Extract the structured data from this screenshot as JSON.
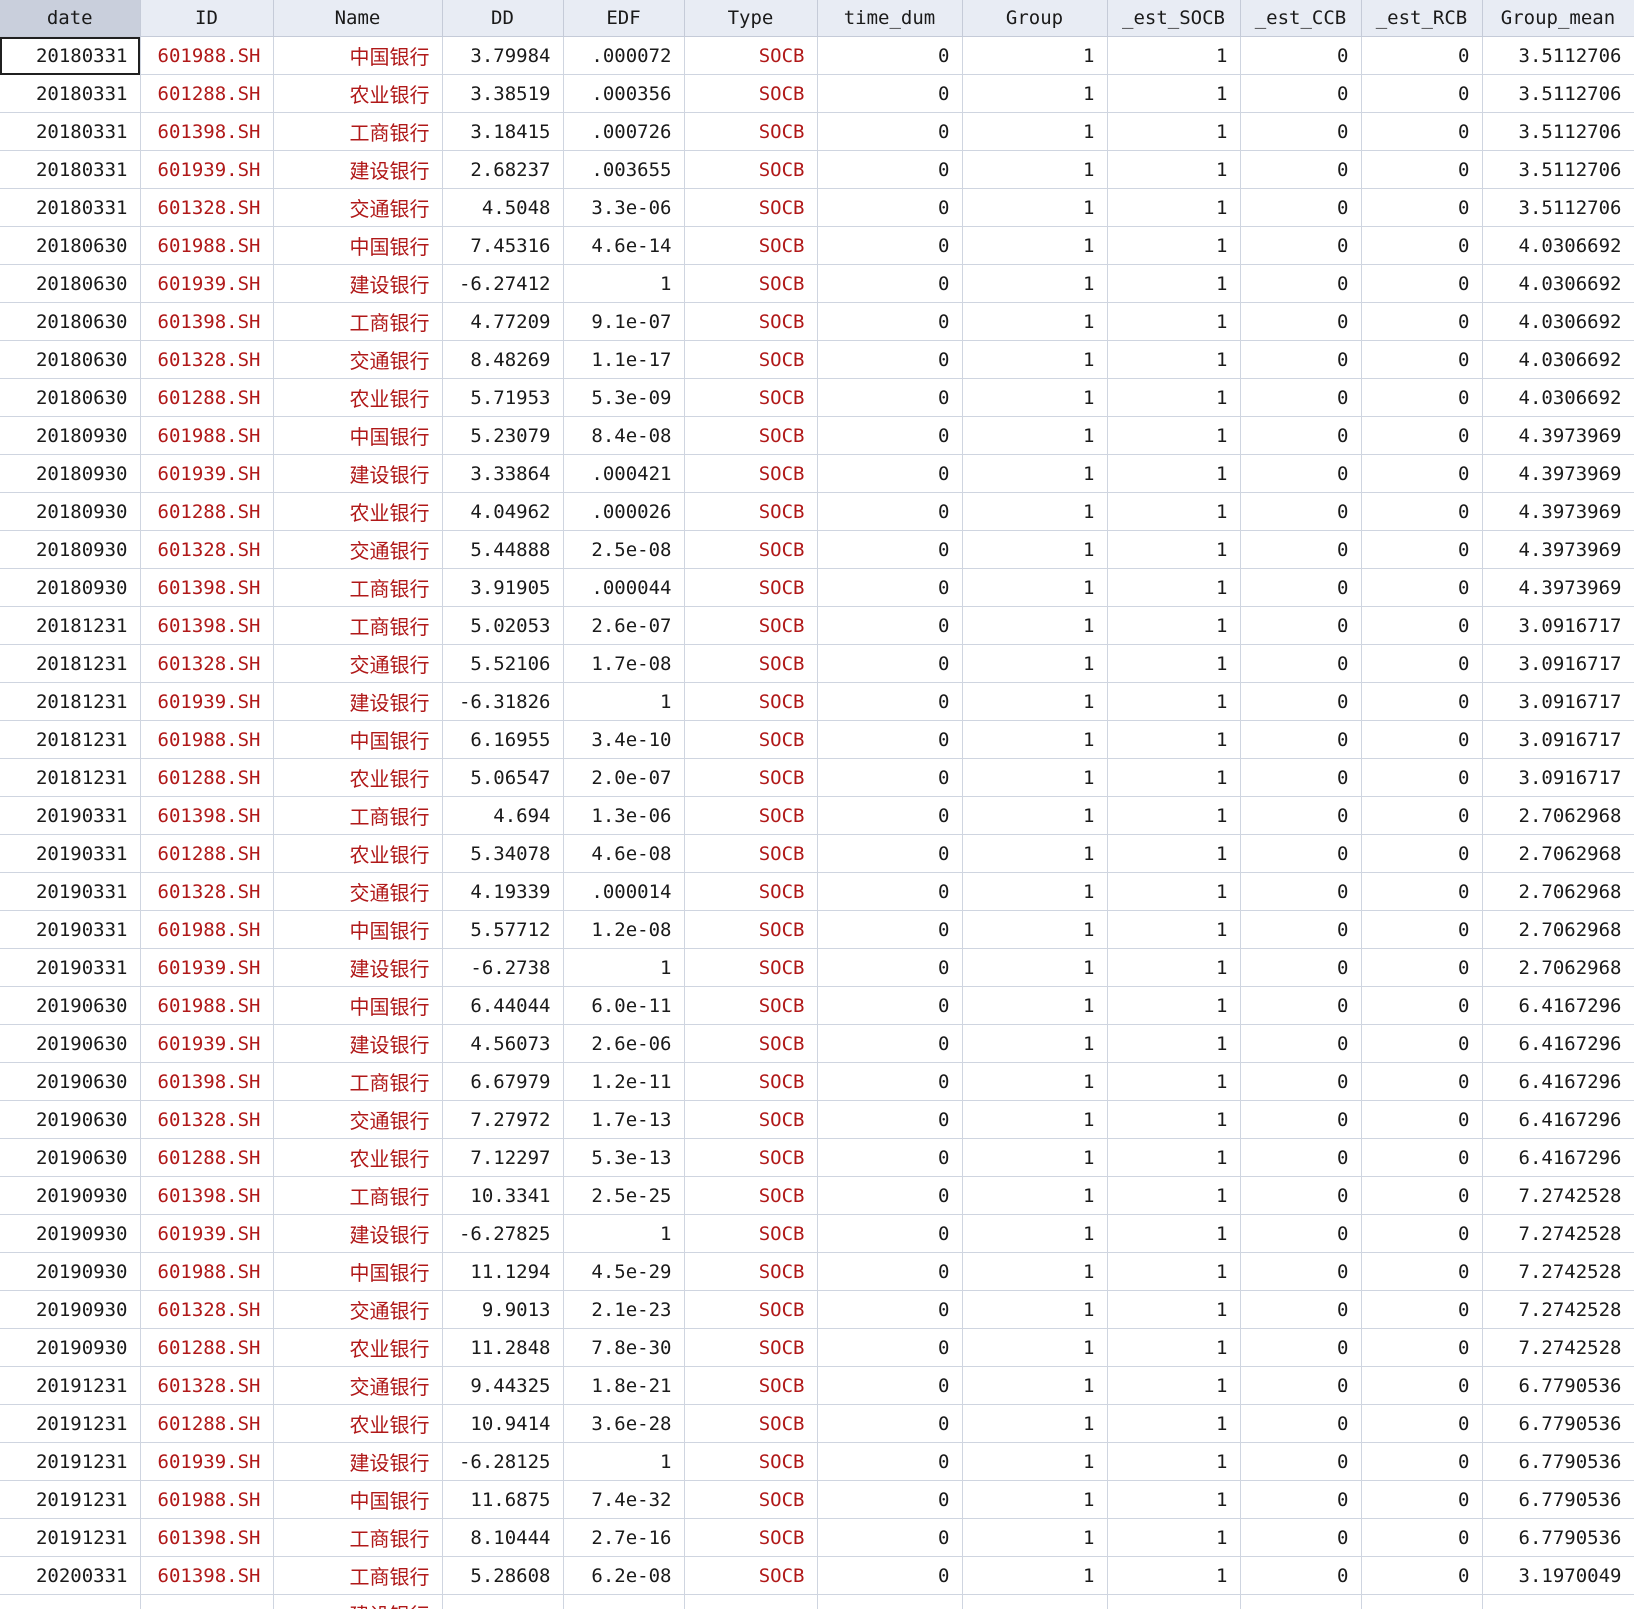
{
  "columns": [
    "date",
    "ID",
    "Name",
    "DD",
    "EDF",
    "Type",
    "time_dum",
    "Group",
    "_est_SOCB",
    "_est_CCB",
    "_est_RCB",
    "Group_mean"
  ],
  "string_columns": [
    "ID",
    "Name",
    "Type"
  ],
  "selected_cell": {
    "row": 0,
    "column": "date"
  },
  "colors": {
    "string_text": "#b01818",
    "header_bg": "#e8ecf4",
    "gridline": "#cfd5e0"
  },
  "rows": [
    [
      "20180331",
      "601988.SH",
      "中国银行",
      "3.79984",
      ".000072",
      "SOCB",
      "0",
      "1",
      "1",
      "0",
      "0",
      "3.5112706"
    ],
    [
      "20180331",
      "601288.SH",
      "农业银行",
      "3.38519",
      ".000356",
      "SOCB",
      "0",
      "1",
      "1",
      "0",
      "0",
      "3.5112706"
    ],
    [
      "20180331",
      "601398.SH",
      "工商银行",
      "3.18415",
      ".000726",
      "SOCB",
      "0",
      "1",
      "1",
      "0",
      "0",
      "3.5112706"
    ],
    [
      "20180331",
      "601939.SH",
      "建设银行",
      "2.68237",
      ".003655",
      "SOCB",
      "0",
      "1",
      "1",
      "0",
      "0",
      "3.5112706"
    ],
    [
      "20180331",
      "601328.SH",
      "交通银行",
      "4.5048",
      "3.3e-06",
      "SOCB",
      "0",
      "1",
      "1",
      "0",
      "0",
      "3.5112706"
    ],
    [
      "20180630",
      "601988.SH",
      "中国银行",
      "7.45316",
      "4.6e-14",
      "SOCB",
      "0",
      "1",
      "1",
      "0",
      "0",
      "4.0306692"
    ],
    [
      "20180630",
      "601939.SH",
      "建设银行",
      "-6.27412",
      "1",
      "SOCB",
      "0",
      "1",
      "1",
      "0",
      "0",
      "4.0306692"
    ],
    [
      "20180630",
      "601398.SH",
      "工商银行",
      "4.77209",
      "9.1e-07",
      "SOCB",
      "0",
      "1",
      "1",
      "0",
      "0",
      "4.0306692"
    ],
    [
      "20180630",
      "601328.SH",
      "交通银行",
      "8.48269",
      "1.1e-17",
      "SOCB",
      "0",
      "1",
      "1",
      "0",
      "0",
      "4.0306692"
    ],
    [
      "20180630",
      "601288.SH",
      "农业银行",
      "5.71953",
      "5.3e-09",
      "SOCB",
      "0",
      "1",
      "1",
      "0",
      "0",
      "4.0306692"
    ],
    [
      "20180930",
      "601988.SH",
      "中国银行",
      "5.23079",
      "8.4e-08",
      "SOCB",
      "0",
      "1",
      "1",
      "0",
      "0",
      "4.3973969"
    ],
    [
      "20180930",
      "601939.SH",
      "建设银行",
      "3.33864",
      ".000421",
      "SOCB",
      "0",
      "1",
      "1",
      "0",
      "0",
      "4.3973969"
    ],
    [
      "20180930",
      "601288.SH",
      "农业银行",
      "4.04962",
      ".000026",
      "SOCB",
      "0",
      "1",
      "1",
      "0",
      "0",
      "4.3973969"
    ],
    [
      "20180930",
      "601328.SH",
      "交通银行",
      "5.44888",
      "2.5e-08",
      "SOCB",
      "0",
      "1",
      "1",
      "0",
      "0",
      "4.3973969"
    ],
    [
      "20180930",
      "601398.SH",
      "工商银行",
      "3.91905",
      ".000044",
      "SOCB",
      "0",
      "1",
      "1",
      "0",
      "0",
      "4.3973969"
    ],
    [
      "20181231",
      "601398.SH",
      "工商银行",
      "5.02053",
      "2.6e-07",
      "SOCB",
      "0",
      "1",
      "1",
      "0",
      "0",
      "3.0916717"
    ],
    [
      "20181231",
      "601328.SH",
      "交通银行",
      "5.52106",
      "1.7e-08",
      "SOCB",
      "0",
      "1",
      "1",
      "0",
      "0",
      "3.0916717"
    ],
    [
      "20181231",
      "601939.SH",
      "建设银行",
      "-6.31826",
      "1",
      "SOCB",
      "0",
      "1",
      "1",
      "0",
      "0",
      "3.0916717"
    ],
    [
      "20181231",
      "601988.SH",
      "中国银行",
      "6.16955",
      "3.4e-10",
      "SOCB",
      "0",
      "1",
      "1",
      "0",
      "0",
      "3.0916717"
    ],
    [
      "20181231",
      "601288.SH",
      "农业银行",
      "5.06547",
      "2.0e-07",
      "SOCB",
      "0",
      "1",
      "1",
      "0",
      "0",
      "3.0916717"
    ],
    [
      "20190331",
      "601398.SH",
      "工商银行",
      "4.694",
      "1.3e-06",
      "SOCB",
      "0",
      "1",
      "1",
      "0",
      "0",
      "2.7062968"
    ],
    [
      "20190331",
      "601288.SH",
      "农业银行",
      "5.34078",
      "4.6e-08",
      "SOCB",
      "0",
      "1",
      "1",
      "0",
      "0",
      "2.7062968"
    ],
    [
      "20190331",
      "601328.SH",
      "交通银行",
      "4.19339",
      ".000014",
      "SOCB",
      "0",
      "1",
      "1",
      "0",
      "0",
      "2.7062968"
    ],
    [
      "20190331",
      "601988.SH",
      "中国银行",
      "5.57712",
      "1.2e-08",
      "SOCB",
      "0",
      "1",
      "1",
      "0",
      "0",
      "2.7062968"
    ],
    [
      "20190331",
      "601939.SH",
      "建设银行",
      "-6.2738",
      "1",
      "SOCB",
      "0",
      "1",
      "1",
      "0",
      "0",
      "2.7062968"
    ],
    [
      "20190630",
      "601988.SH",
      "中国银行",
      "6.44044",
      "6.0e-11",
      "SOCB",
      "0",
      "1",
      "1",
      "0",
      "0",
      "6.4167296"
    ],
    [
      "20190630",
      "601939.SH",
      "建设银行",
      "4.56073",
      "2.6e-06",
      "SOCB",
      "0",
      "1",
      "1",
      "0",
      "0",
      "6.4167296"
    ],
    [
      "20190630",
      "601398.SH",
      "工商银行",
      "6.67979",
      "1.2e-11",
      "SOCB",
      "0",
      "1",
      "1",
      "0",
      "0",
      "6.4167296"
    ],
    [
      "20190630",
      "601328.SH",
      "交通银行",
      "7.27972",
      "1.7e-13",
      "SOCB",
      "0",
      "1",
      "1",
      "0",
      "0",
      "6.4167296"
    ],
    [
      "20190630",
      "601288.SH",
      "农业银行",
      "7.12297",
      "5.3e-13",
      "SOCB",
      "0",
      "1",
      "1",
      "0",
      "0",
      "6.4167296"
    ],
    [
      "20190930",
      "601398.SH",
      "工商银行",
      "10.3341",
      "2.5e-25",
      "SOCB",
      "0",
      "1",
      "1",
      "0",
      "0",
      "7.2742528"
    ],
    [
      "20190930",
      "601939.SH",
      "建设银行",
      "-6.27825",
      "1",
      "SOCB",
      "0",
      "1",
      "1",
      "0",
      "0",
      "7.2742528"
    ],
    [
      "20190930",
      "601988.SH",
      "中国银行",
      "11.1294",
      "4.5e-29",
      "SOCB",
      "0",
      "1",
      "1",
      "0",
      "0",
      "7.2742528"
    ],
    [
      "20190930",
      "601328.SH",
      "交通银行",
      "9.9013",
      "2.1e-23",
      "SOCB",
      "0",
      "1",
      "1",
      "0",
      "0",
      "7.2742528"
    ],
    [
      "20190930",
      "601288.SH",
      "农业银行",
      "11.2848",
      "7.8e-30",
      "SOCB",
      "0",
      "1",
      "1",
      "0",
      "0",
      "7.2742528"
    ],
    [
      "20191231",
      "601328.SH",
      "交通银行",
      "9.44325",
      "1.8e-21",
      "SOCB",
      "0",
      "1",
      "1",
      "0",
      "0",
      "6.7790536"
    ],
    [
      "20191231",
      "601288.SH",
      "农业银行",
      "10.9414",
      "3.6e-28",
      "SOCB",
      "0",
      "1",
      "1",
      "0",
      "0",
      "6.7790536"
    ],
    [
      "20191231",
      "601939.SH",
      "建设银行",
      "-6.28125",
      "1",
      "SOCB",
      "0",
      "1",
      "1",
      "0",
      "0",
      "6.7790536"
    ],
    [
      "20191231",
      "601988.SH",
      "中国银行",
      "11.6875",
      "7.4e-32",
      "SOCB",
      "0",
      "1",
      "1",
      "0",
      "0",
      "6.7790536"
    ],
    [
      "20191231",
      "601398.SH",
      "工商银行",
      "8.10444",
      "2.7e-16",
      "SOCB",
      "0",
      "1",
      "1",
      "0",
      "0",
      "6.7790536"
    ],
    [
      "20200331",
      "601398.SH",
      "工商银行",
      "5.28608",
      "6.2e-08",
      "SOCB",
      "0",
      "1",
      "1",
      "0",
      "0",
      "3.1970049"
    ]
  ],
  "partial_row": [
    "",
    "",
    "建设银行",
    "",
    "",
    "",
    "",
    "",
    "",
    "",
    "",
    ""
  ]
}
